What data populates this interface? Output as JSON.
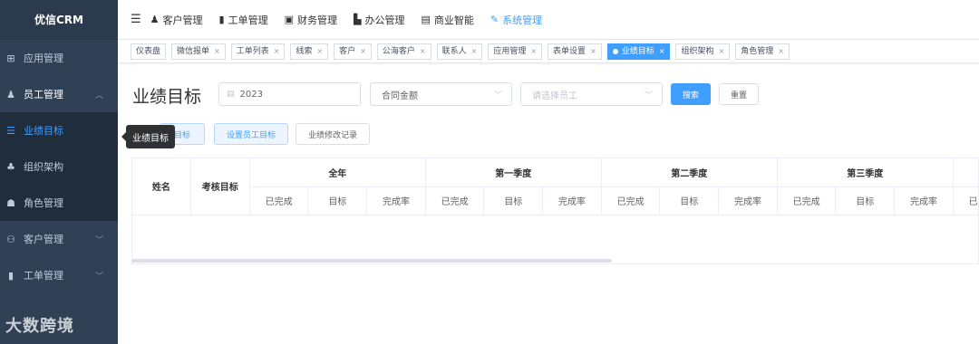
{
  "sidebar": {
    "logo": "优信CRM",
    "items": [
      {
        "label": "应用管理",
        "icon": "grid-icon"
      },
      {
        "label": "员工管理",
        "icon": "user-icon"
      },
      {
        "label": "业绩目标",
        "icon": "target-list-icon"
      },
      {
        "label": "组织架构",
        "icon": "org-icon"
      },
      {
        "label": "角色管理",
        "icon": "role-icon"
      },
      {
        "label": "客户管理",
        "icon": "customer-icon"
      },
      {
        "label": "工单管理",
        "icon": "ticket-icon"
      }
    ],
    "watermark": "大数跨境"
  },
  "topnav": {
    "items": [
      {
        "label": "客户管理",
        "icon": "customers-icon"
      },
      {
        "label": "工单管理",
        "icon": "clipboard-icon"
      },
      {
        "label": "财务管理",
        "icon": "finance-icon"
      },
      {
        "label": "办公管理",
        "icon": "office-icon"
      },
      {
        "label": "商业智能",
        "icon": "bi-icon"
      },
      {
        "label": "系统管理",
        "icon": "wrench-icon"
      }
    ]
  },
  "tags": [
    "仪表盘",
    "微信报单",
    "工单列表",
    "线索",
    "客户",
    "公海客户",
    "联系人",
    "应用管理",
    "表单设置",
    "业绩目标",
    "组织架构",
    "角色管理"
  ],
  "page": {
    "title": "业绩目标",
    "year_value": "2023",
    "metric_value": "合同金额",
    "employee_placeholder": "请选择员工",
    "search_label": "搜索",
    "reset_label": "重置",
    "set_target_label": "目标",
    "set_employee_target_label": "设置员工目标",
    "change_log_label": "业绩修改记录",
    "tooltip": "业绩目标"
  },
  "table": {
    "name_header": "姓名",
    "target_header": "考核目标",
    "groups": [
      "全年",
      "第一季度",
      "第二季度",
      "第三季度"
    ],
    "sub_headers": [
      "已完成",
      "目标",
      "完成率"
    ],
    "last_sub": "已完成"
  }
}
